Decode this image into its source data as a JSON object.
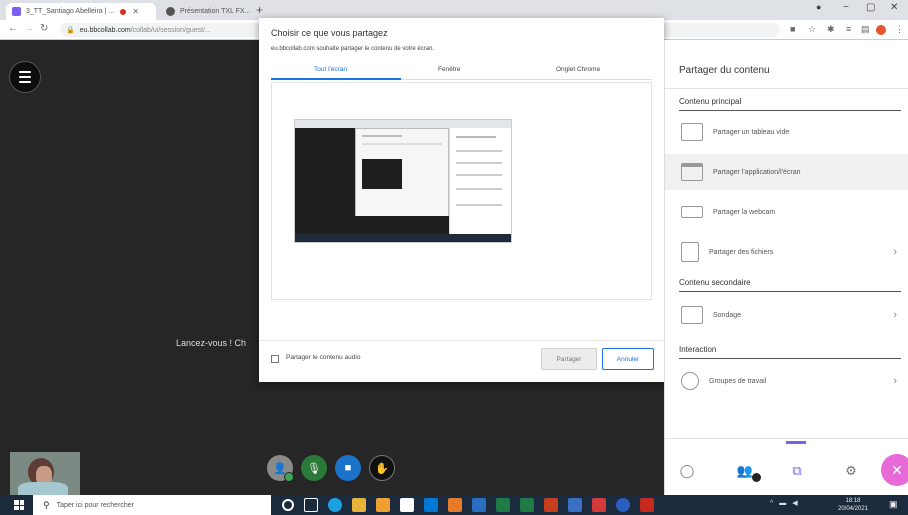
{
  "browser": {
    "tabs": [
      {
        "title": "3_TT_Santiago Abelleira | ...",
        "active": true
      },
      {
        "title": "Présentation TXL FX...",
        "active": false
      }
    ],
    "newtab_label": "+",
    "url_host": "eu.bbcollab.com",
    "url_path": "/collab/ui/session/guest/...",
    "win_controls": {
      "minimize": "−",
      "maximize": "▢",
      "close": "✕"
    }
  },
  "stage": {
    "center_text": "Lancez-vous ! Ch"
  },
  "dialog": {
    "title": "Choisir ce que vous partagez",
    "subtitle": "eu.bbcollab.com souhaite partager le contenu de votre écran.",
    "tabs": [
      "Tout l'écran",
      "Fenêtre",
      "Onglet Chrome"
    ],
    "active_tab": 0,
    "audio_label": "Partager le contenu audio",
    "share_button": "Partager",
    "cancel_button": "Annuler"
  },
  "panel": {
    "title": "Partager du contenu",
    "primary_section": "Contenu principal",
    "primary_items": [
      {
        "label": "Partager un tableau vide",
        "icon": "whiteboard-icon",
        "chevron": false
      },
      {
        "label": "Partager l'application/l'écran",
        "icon": "screen-share-icon",
        "chevron": false
      },
      {
        "label": "Partager la webcam",
        "icon": "webcam-icon",
        "chevron": false
      },
      {
        "label": "Partager des fichiers",
        "icon": "files-icon",
        "chevron": true
      }
    ],
    "secondary_section": "Contenu secondaire",
    "secondary_items": [
      {
        "label": "Sondage",
        "icon": "poll-icon",
        "chevron": true
      }
    ],
    "interaction_section": "Interaction",
    "interaction_items": [
      {
        "label": "Groupes de travail",
        "icon": "groups-icon",
        "chevron": true
      }
    ]
  },
  "taskbar": {
    "search_placeholder": "Taper ici pour rechercher",
    "time": "18:18",
    "date": "20/04/2021"
  },
  "colors": {
    "accent": "#1a73e8",
    "collab_purple": "#7a5ff0",
    "close_pink": "#e86ad8",
    "mic_green": "#2a7a3a",
    "cam_blue": "#1a73c9"
  }
}
